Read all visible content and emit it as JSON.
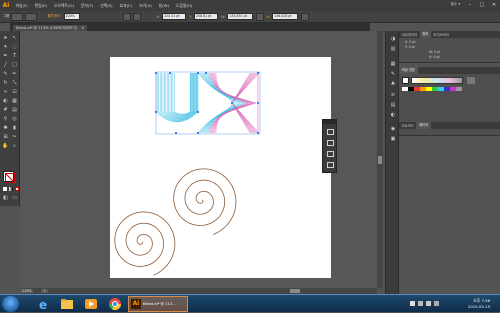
{
  "app": {
    "logo": "Ai",
    "essentials_label": "필수 ▾"
  },
  "menu": [
    "파일(F)",
    "편집(E)",
    "오브젝트(O)",
    "문자(T)",
    "선택(S)",
    "효과(C)",
    "보기(V)",
    "창(W)",
    "도움말(H)"
  ],
  "window_controls": {
    "minimize": "–",
    "maximize": "□",
    "close": "✕"
  },
  "control_bar": {
    "selection_label": "그룹",
    "opacity_label": "불투명도:",
    "opacity_value": "100%",
    "x_label": "X:",
    "x_value": "224.41 pt",
    "y_label": "Y:",
    "y_value": "208.81 pt",
    "w_label": "W:",
    "w_value": "133.831 pt",
    "h_label": "H:",
    "h_value": "146.028 pt"
  },
  "document": {
    "tab_title": "Blend.ai* @ 113% (CMYK/미리보기)",
    "close": "✕"
  },
  "status_bar": {
    "zoom": "113%",
    "artboard": "1"
  },
  "panels": {
    "navigator": {
      "tabs": [
        "내비게이터",
        "정보",
        "라이브러리"
      ],
      "active_tab": "정보",
      "x": "X: 0 pt",
      "y": "Y: 0 pt",
      "w": "W: 0 pt",
      "h": "H: 0 pt"
    },
    "color": {
      "tabs": [
        "색상 견본"
      ]
    },
    "layers": {
      "tabs": [
        "아트보드",
        "레이어"
      ],
      "active_tab": "레이어"
    }
  },
  "taskbar": {
    "ai_task_label": "Blend.ai* @ 113...",
    "time": "오후 7:36",
    "date": "2015-05-15"
  },
  "colors": {
    "accent": "#ff9a00",
    "blend_cyan": "#3fbfe6",
    "blend_magenta": "#d866b6",
    "spiral": "#8a5a3a",
    "taskbar": "#1d4a6e"
  },
  "icons": [
    "ai-logo-icon",
    "selection-tool-icon",
    "direct-selection-icon",
    "pen-tool-icon",
    "type-tool-icon",
    "line-tool-icon",
    "rectangle-tool-icon",
    "brush-tool-icon",
    "rotate-tool-icon",
    "scale-tool-icon",
    "blend-tool-icon",
    "gradient-tool-icon",
    "hand-tool-icon",
    "zoom-tool-icon",
    "fill-swatch-icon",
    "stroke-swatch-icon",
    "start-button-icon",
    "ie-icon",
    "explorer-icon",
    "media-icon",
    "chrome-icon",
    "ai-task-icon"
  ]
}
